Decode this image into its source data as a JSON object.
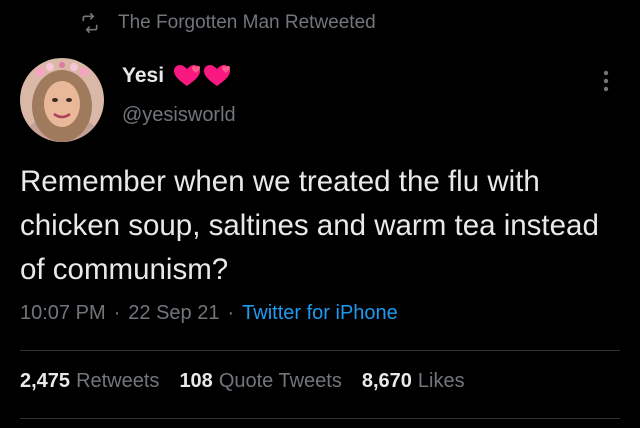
{
  "retweet": {
    "icon": "retweet-icon",
    "text": "The Forgotten Man Retweeted"
  },
  "author": {
    "display_name": "Yesi",
    "name_emoji": [
      "heart-emoji",
      "heart-emoji"
    ],
    "handle": "@yesisworld",
    "avatar": "profile-avatar"
  },
  "more_icon": "more-options-icon",
  "tweet": {
    "text": "Remember when we treated the flu with chicken soup, saltines and warm tea instead of communism?"
  },
  "meta": {
    "time": "10:07 PM",
    "separator": "·",
    "date": "22 Sep 21",
    "source": "Twitter for iPhone"
  },
  "stats": {
    "retweets": {
      "count": "2,475",
      "label": "Retweets"
    },
    "quotes": {
      "count": "108",
      "label": "Quote Tweets"
    },
    "likes": {
      "count": "8,670",
      "label": "Likes"
    }
  },
  "colors": {
    "background": "#000000",
    "text": "#e7e9ea",
    "secondary": "#71767b",
    "link": "#1d9bf0",
    "divider": "#2f3336",
    "heart": "#f91880"
  }
}
